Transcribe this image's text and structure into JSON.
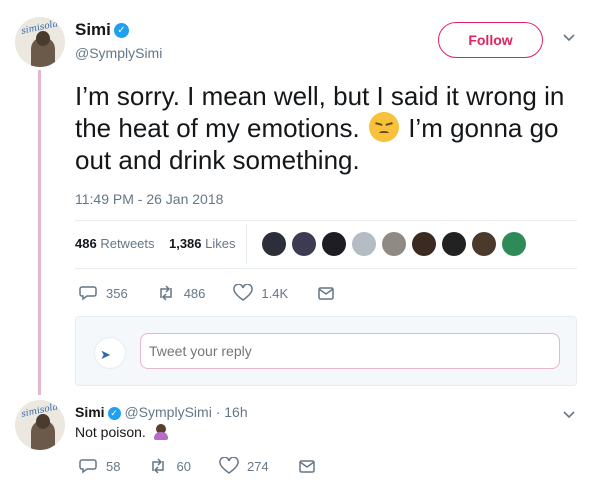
{
  "tweet": {
    "author_name": "Simi",
    "author_handle": "@SymplySimi",
    "follow_label": "Follow",
    "text_part1": "I’m sorry. I mean well, but I said it wrong in the heat of my emotions.",
    "emoji_1": "disappointed-face-emoji",
    "text_part2": "I’m gonna go out and drink something.",
    "timestamp": "11:49 PM - 26 Jan 2018",
    "retweets_count": "486",
    "retweets_label": "Retweets",
    "likes_count": "1,386",
    "likes_label": "Likes",
    "liker_colors": [
      "#2c2f3a",
      "#3d3b52",
      "#1f1d24",
      "#b5bcc4",
      "#8f8a84",
      "#3a2a22",
      "#222222",
      "#4b3a2c",
      "#2e8b57"
    ],
    "actions": {
      "replies": "356",
      "retweets": "486",
      "likes": "1.4K"
    }
  },
  "reply_composer": {
    "placeholder": "Tweet your reply",
    "avatar_icon": "bird-logo-icon"
  },
  "reply": {
    "author_name": "Simi",
    "author_handle": "@SymplySimi",
    "time": "· 16h",
    "text": "Not poison.",
    "emoji": "woman-emoji",
    "actions": {
      "replies": "58",
      "retweets": "60",
      "likes": "274"
    }
  },
  "colors": {
    "accent_pink": "#e0245e",
    "verified_blue": "#1da1f2",
    "muted": "#657786",
    "thread_line": "#e4b6d0"
  }
}
